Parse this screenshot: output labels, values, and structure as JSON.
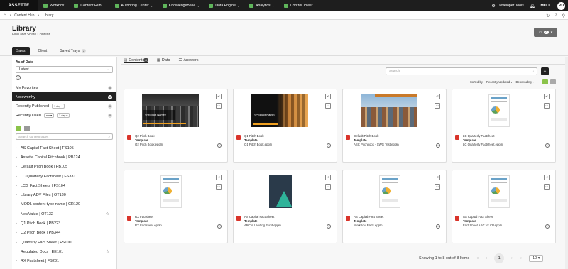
{
  "topnav": {
    "brand": "ASSETTE",
    "items": [
      {
        "label": "Workbox",
        "has_caret": false
      },
      {
        "label": "Content Hub",
        "has_caret": true
      },
      {
        "label": "Authoring Center",
        "has_caret": true
      },
      {
        "label": "KnowledgeBase",
        "has_caret": true
      },
      {
        "label": "Data Engine",
        "has_caret": true
      },
      {
        "label": "Analytics",
        "has_caret": true
      },
      {
        "label": "Control Tower",
        "has_caret": false
      }
    ],
    "developer_tools": "Developer Tools",
    "user_code": "MOOL",
    "avatar_initials": "PD"
  },
  "breadcrumb": {
    "items": [
      "Content Hub",
      "Library"
    ]
  },
  "page": {
    "title": "Library",
    "subtitle": "Find and Share Content",
    "tray_count": "0"
  },
  "left_tabs": [
    {
      "label": "Sales",
      "active": true
    },
    {
      "label": "Client",
      "active": false
    },
    {
      "label": "Saved Trays",
      "count": "2",
      "active": false
    }
  ],
  "filters": {
    "as_of_label": "As of Date",
    "as_of_value": "Latest",
    "rows": [
      {
        "label": "My Favorites",
        "badge": "0",
        "active": false
      },
      {
        "label": "Noteworthy",
        "badge": "8",
        "active": true
      },
      {
        "label": "Recently Published",
        "chip1": "1 day",
        "badge": "0",
        "active": false
      },
      {
        "label": "Recently Used",
        "chip1": "me",
        "chip2": "1 day",
        "badge": "0",
        "active": false
      }
    ]
  },
  "content_types": {
    "search_placeholder": "Search content types",
    "items": [
      {
        "label": "AS Capital Fact Sheet | FS105",
        "caret": true,
        "star": false
      },
      {
        "label": "Assette Capital Pitchbook | PB124",
        "caret": true,
        "star": false
      },
      {
        "label": "Default Pitch Book | PB105",
        "caret": true,
        "star": false
      },
      {
        "label": "LC Quarterly Factsheet | FS331",
        "caret": true,
        "star": false
      },
      {
        "label": "LCG Fact Sheets | FS104",
        "caret": true,
        "star": false
      },
      {
        "label": "Library ADV Files | OT130",
        "caret": true,
        "star": false
      },
      {
        "label": "MODL content type name | CR120",
        "caret": true,
        "star": false
      },
      {
        "label": "NewValue | OT132",
        "caret": false,
        "star": true
      },
      {
        "label": "Q1 Pitch Book | PB223",
        "caret": true,
        "star": false
      },
      {
        "label": "Q2 Pitch Book | PB344",
        "caret": true,
        "star": false
      },
      {
        "label": "Quarterly Fact Sheet | FS100",
        "caret": true,
        "star": false
      },
      {
        "label": "Regulated Docs | EE101",
        "caret": false,
        "star": true
      },
      {
        "label": "RX Factsheet | FS231",
        "caret": true,
        "star": false
      }
    ]
  },
  "main_tabs": [
    {
      "label": "Content",
      "count": "8",
      "active": true
    },
    {
      "label": "Data",
      "active": false
    },
    {
      "label": "Answers",
      "active": false
    }
  ],
  "search": {
    "placeholder": "Search"
  },
  "sort": {
    "label": "Sorted by",
    "field": "Recently Updated",
    "order": "Descending"
  },
  "cards": [
    {
      "name": "Q2 Pitch Book",
      "type": "Template",
      "file": "Q2 Pitch Book.eppln",
      "thumb": "city-dark",
      "thumb_text": "<Product Name>"
    },
    {
      "name": "Q1 Pitch Book",
      "type": "Template",
      "file": "Q1 Pitch Book.eppln",
      "thumb": "city-sunset",
      "thumb_text": "<Product Name>"
    },
    {
      "name": "Default Pitch Book",
      "type": "Template",
      "file": "ASC Pitchbook - SWG Test.eppln",
      "thumb": "skyline",
      "thumb_text": ""
    },
    {
      "name": "LC Quarterly Factsheet",
      "type": "Template",
      "file": "LC Quarterly Factsheet.eppln",
      "thumb": "doc",
      "thumb_text": ""
    },
    {
      "name": "RX Factsheet",
      "type": "Template",
      "file": "RX Factsheet.eppln",
      "thumb": "doc",
      "thumb_text": ""
    },
    {
      "name": "AS Capital Fact Sheet",
      "type": "Template",
      "file": "ARCM Landing Fund.eppln",
      "thumb": "teal",
      "thumb_text": ""
    },
    {
      "name": "AS Capital Fact Sheet",
      "type": "Template",
      "file": "Workflow Parts.eppln",
      "thumb": "doc",
      "thumb_text": ""
    },
    {
      "name": "AS Capital Fact Sheet",
      "type": "Template",
      "file": "Fact Sheet ASC for CP.eppln",
      "thumb": "doc",
      "thumb_text": ""
    }
  ],
  "pagination": {
    "summary": "Showing 1 to 8 out of 8 Items",
    "current_page": "1",
    "page_size": "10"
  },
  "colors": {
    "topbar": "#1e1e1e",
    "accent_green": "#5fb55b",
    "active_dark": "#222222",
    "pdf_red": "#d9342b"
  }
}
